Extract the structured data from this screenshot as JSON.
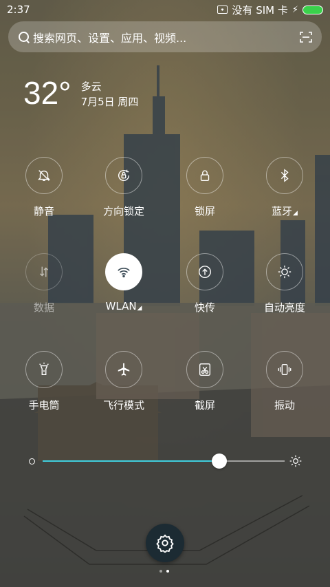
{
  "status_bar": {
    "time": "2:37",
    "sim_text": "没有 SIM 卡",
    "battery_color": "#3ad14b"
  },
  "search": {
    "placeholder": "搜索网页、设置、应用、视频..."
  },
  "weather": {
    "temperature": "32°",
    "condition": "多云",
    "date": "7月5日 周四"
  },
  "toggles": [
    {
      "label": "静音",
      "icon": "mute-bell-icon",
      "state": "off"
    },
    {
      "label": "方向锁定",
      "icon": "rotation-lock-icon",
      "state": "off"
    },
    {
      "label": "锁屏",
      "icon": "lock-icon",
      "state": "off"
    },
    {
      "label": "蓝牙",
      "icon": "bluetooth-icon",
      "state": "off"
    },
    {
      "label": "数据",
      "icon": "mobile-data-icon",
      "state": "disabled"
    },
    {
      "label": "WLAN",
      "icon": "wifi-icon",
      "state": "on"
    },
    {
      "label": "快传",
      "icon": "quick-transfer-icon",
      "state": "off"
    },
    {
      "label": "自动亮度",
      "icon": "auto-brightness-icon",
      "state": "off"
    },
    {
      "label": "手电筒",
      "icon": "flashlight-icon",
      "state": "off"
    },
    {
      "label": "飞行模式",
      "icon": "airplane-icon",
      "state": "off"
    },
    {
      "label": "截屏",
      "icon": "screenshot-icon",
      "state": "off"
    },
    {
      "label": "振动",
      "icon": "vibrate-icon",
      "state": "off"
    }
  ],
  "brightness": {
    "level": 0.73,
    "accent": "#3fd0e0"
  },
  "pager": {
    "pages": 2,
    "current": 2
  }
}
